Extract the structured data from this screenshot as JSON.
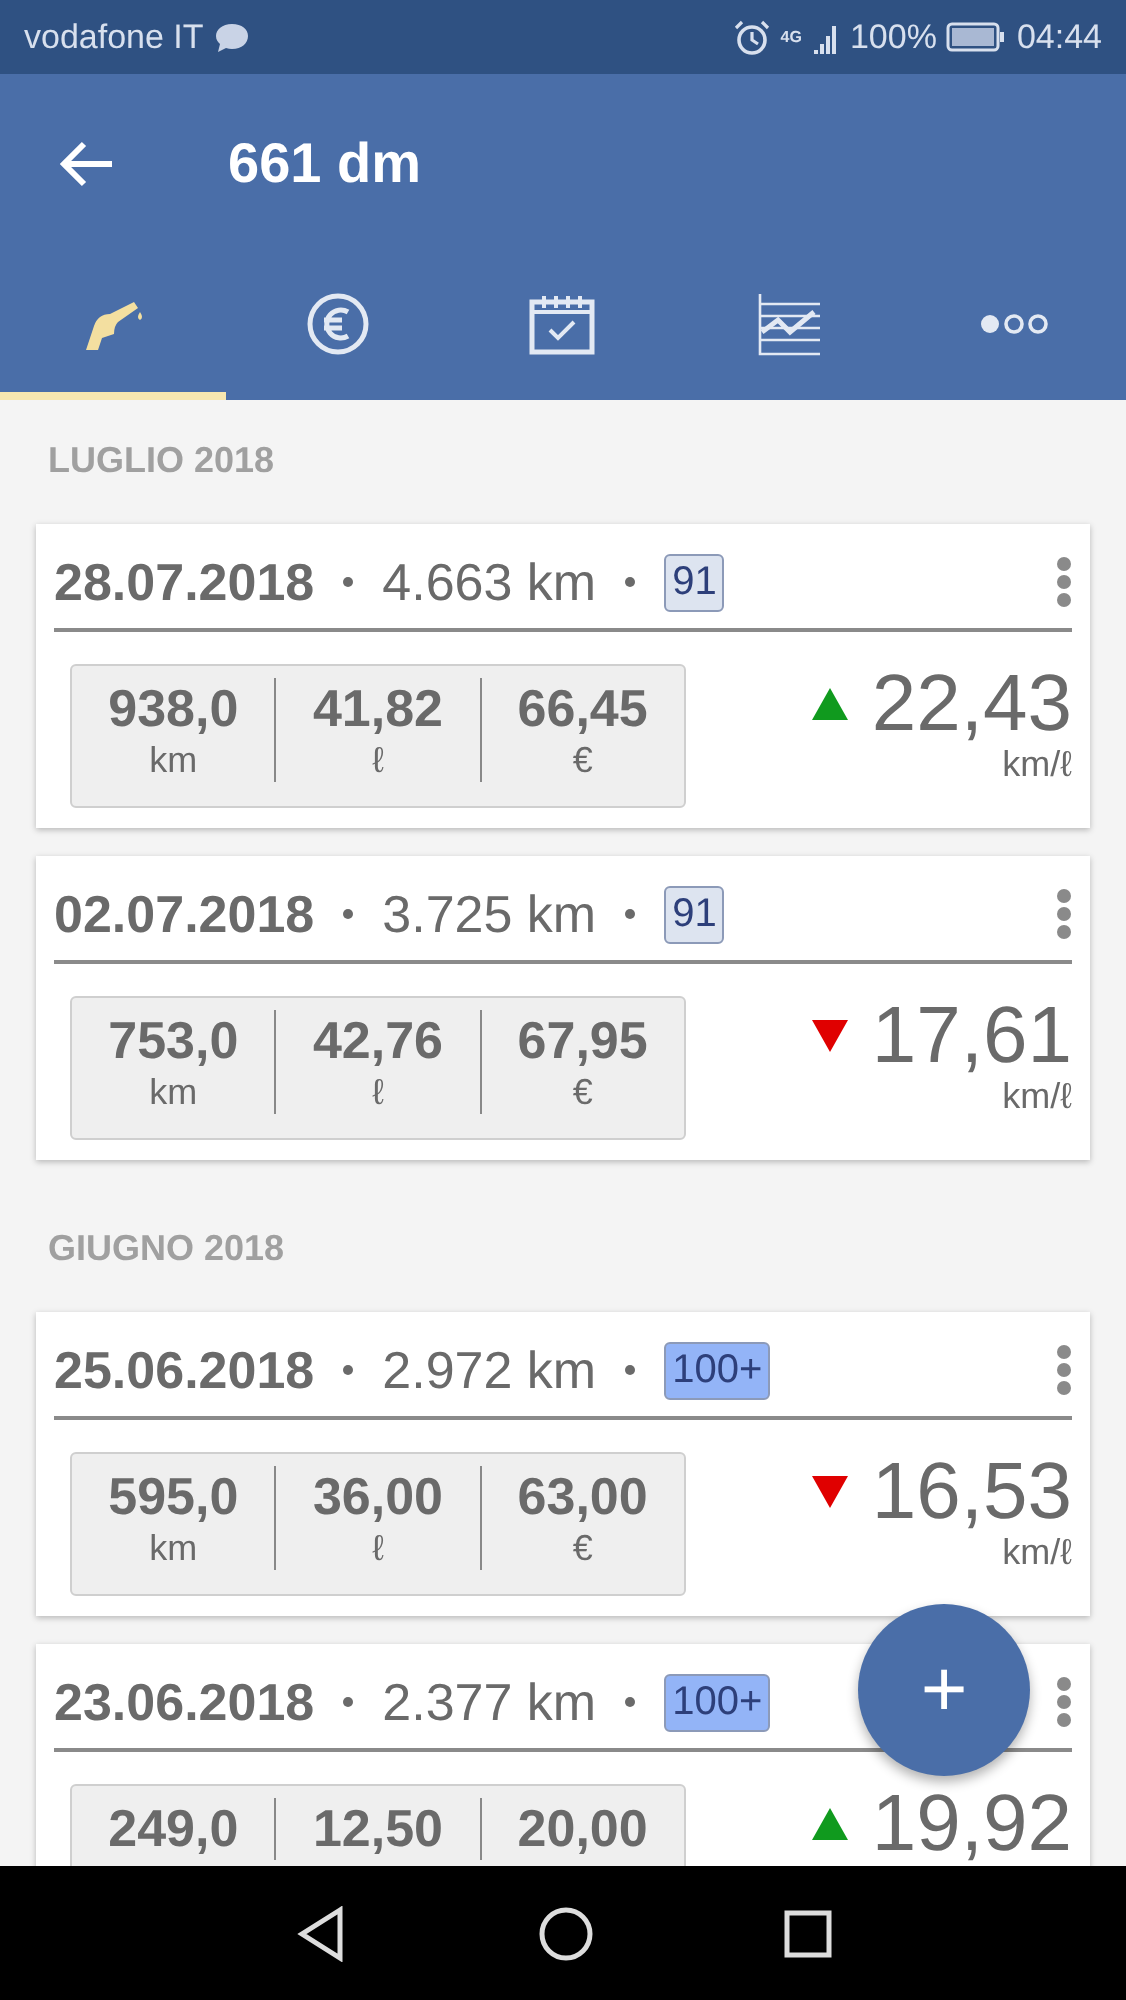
{
  "status_bar": {
    "carrier": "vodafone IT",
    "network": "4G",
    "battery": "100%",
    "time": "04:44"
  },
  "app_bar": {
    "title": "661 dm"
  },
  "tabs": [
    {
      "kind": "fuel",
      "selected": true
    },
    {
      "kind": "costs",
      "selected": false
    },
    {
      "kind": "calendar",
      "selected": false
    },
    {
      "kind": "chart",
      "selected": false
    },
    {
      "kind": "more",
      "selected": false
    }
  ],
  "sections": [
    {
      "title": "LUGLIO 2018",
      "entries": [
        {
          "date": "28.07.2018",
          "odometer": "4.663 km",
          "fuel_badge": {
            "text": "91",
            "color": "#dde4f0"
          },
          "distance": "938,0",
          "distance_unit": "km",
          "volume": "41,82",
          "volume_unit": "ℓ",
          "cost": "66,45",
          "cost_unit": "€",
          "rising": true,
          "consumption": "22,43",
          "consumption_unit": "km/ℓ"
        },
        {
          "date": "02.07.2018",
          "odometer": "3.725 km",
          "fuel_badge": {
            "text": "91",
            "color": "#dde4f0"
          },
          "distance": "753,0",
          "distance_unit": "km",
          "volume": "42,76",
          "volume_unit": "ℓ",
          "cost": "67,95",
          "cost_unit": "€",
          "rising": false,
          "consumption": "17,61",
          "consumption_unit": "km/ℓ"
        }
      ]
    },
    {
      "title": "GIUGNO 2018",
      "entries": [
        {
          "date": "25.06.2018",
          "odometer": "2.972 km",
          "fuel_badge": {
            "text": "100+",
            "color": "#93b4f7"
          },
          "distance": "595,0",
          "distance_unit": "km",
          "volume": "36,00",
          "volume_unit": "ℓ",
          "cost": "63,00",
          "cost_unit": "€",
          "rising": false,
          "consumption": "16,53",
          "consumption_unit": "km/ℓ"
        },
        {
          "date": "23.06.2018",
          "odometer": "2.377 km",
          "fuel_badge": {
            "text": "100+",
            "color": "#93b4f7"
          },
          "distance": "249,0",
          "volume": "12,50",
          "cost": "20,00",
          "rising": true,
          "consumption": "19,92"
        }
      ]
    }
  ],
  "fab": {
    "label": "+"
  }
}
